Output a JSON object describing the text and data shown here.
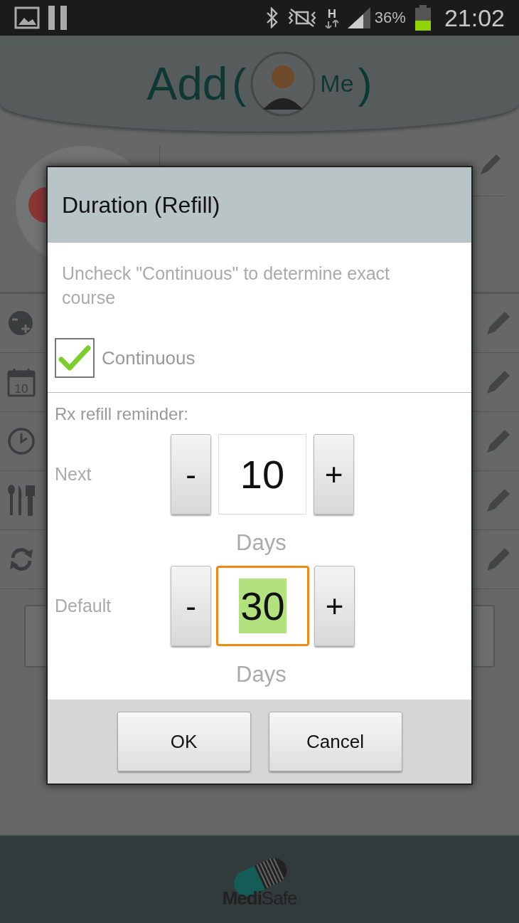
{
  "status_bar": {
    "network": "H",
    "battery": "36%",
    "time": "21:02"
  },
  "header": {
    "title": "Add",
    "paren_open": "(",
    "profile": "Me",
    "paren_close": ")"
  },
  "form": {
    "rows": [
      {
        "kind": "dose"
      },
      {
        "kind": "calendar",
        "day": "10"
      },
      {
        "kind": "clock"
      },
      {
        "kind": "meal"
      },
      {
        "kind": "refill"
      }
    ]
  },
  "dialog": {
    "title": "Duration (Refill)",
    "hint": "Uncheck \"Continuous\" to determine exact course",
    "checkbox": {
      "label": "Continuous",
      "checked": true
    },
    "section_label": "Rx refill reminder:",
    "steppers": [
      {
        "label": "Next",
        "minus": "-",
        "value": "10",
        "plus": "+",
        "unit": "Days",
        "focused": false
      },
      {
        "label": "Default",
        "minus": "-",
        "value": "30",
        "plus": "+",
        "unit": "Days",
        "focused": true
      }
    ],
    "buttons": [
      "OK",
      "Cancel"
    ]
  },
  "logo": "**Medi**Safe"
}
